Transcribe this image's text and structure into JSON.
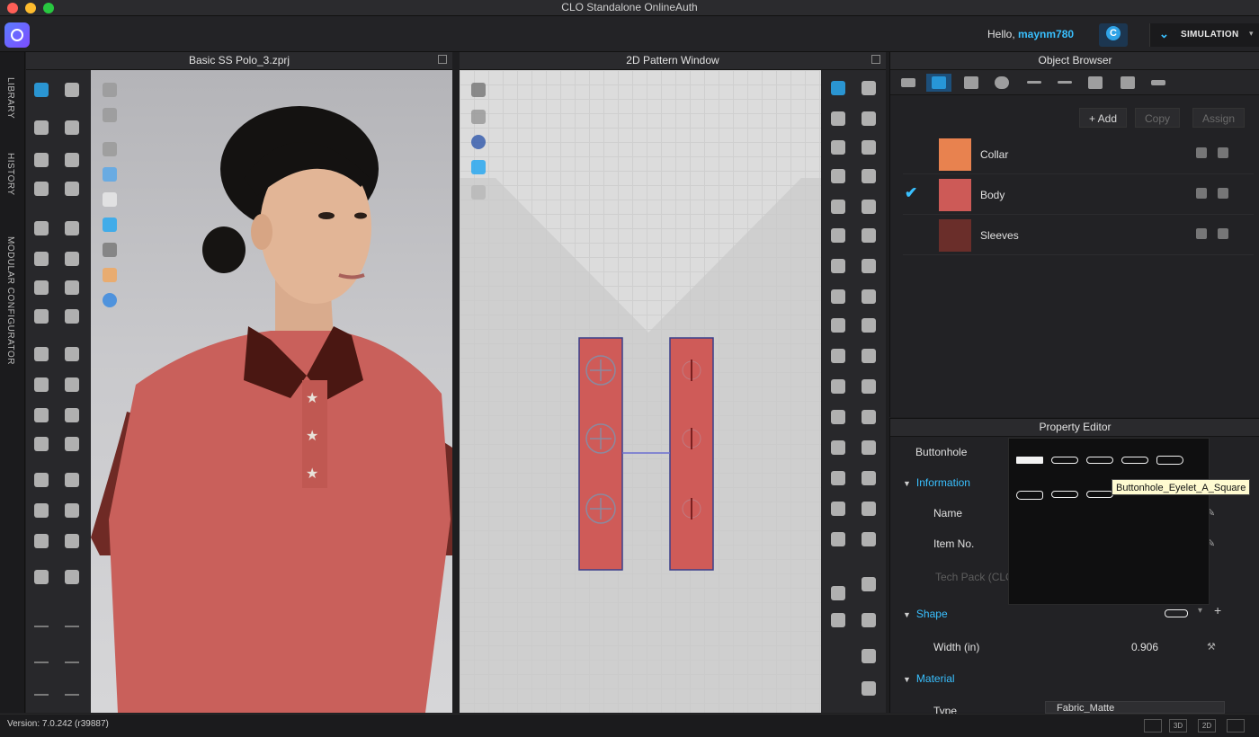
{
  "window": {
    "title": "CLO Standalone OnlineAuth"
  },
  "appbar": {
    "greeting_prefix": "Hello, ",
    "username": "maynm780",
    "simulation_label": "SIMULATION",
    "caret": "▾",
    "cloud_icon": "clo-cloud-icon",
    "accent": "#39c0ff"
  },
  "side_tabs": [
    "LIBRARY",
    "HISTORY",
    "MODULAR CONFIGURATOR"
  ],
  "panel3d": {
    "title": "Basic SS Polo_3.zprj"
  },
  "panel2d": {
    "title": "2D Pattern Window"
  },
  "object_browser": {
    "title": "Object Browser",
    "buttons": {
      "add": "+ Add",
      "copy": "Copy",
      "assign": "Assign"
    },
    "fabrics": [
      {
        "name": "Collar",
        "color": "#e8824f",
        "selected": false
      },
      {
        "name": "Body",
        "color": "#cd5a57",
        "selected": true
      },
      {
        "name": "Sleeves",
        "color": "#6a2e2a",
        "selected": false
      }
    ],
    "check_mark": "✔"
  },
  "property_editor": {
    "title": "Property Editor",
    "buttonhole_label": "Buttonhole",
    "sections": {
      "information": "Information",
      "shape": "Shape",
      "material": "Material"
    },
    "fields": {
      "name": "Name",
      "item_no": "Item No.",
      "tech_pack": "Tech Pack (CLO",
      "width_label": "Width (in)",
      "width_value": "0.906",
      "type_label": "Type",
      "type_value": "Fabric_Matte"
    },
    "tooltip": "Buttonhole_Eyelet_A_Square"
  },
  "status": {
    "version": "Version: 7.0.242 (r39887)",
    "view_3d": "3D",
    "view_2d": "2D"
  }
}
